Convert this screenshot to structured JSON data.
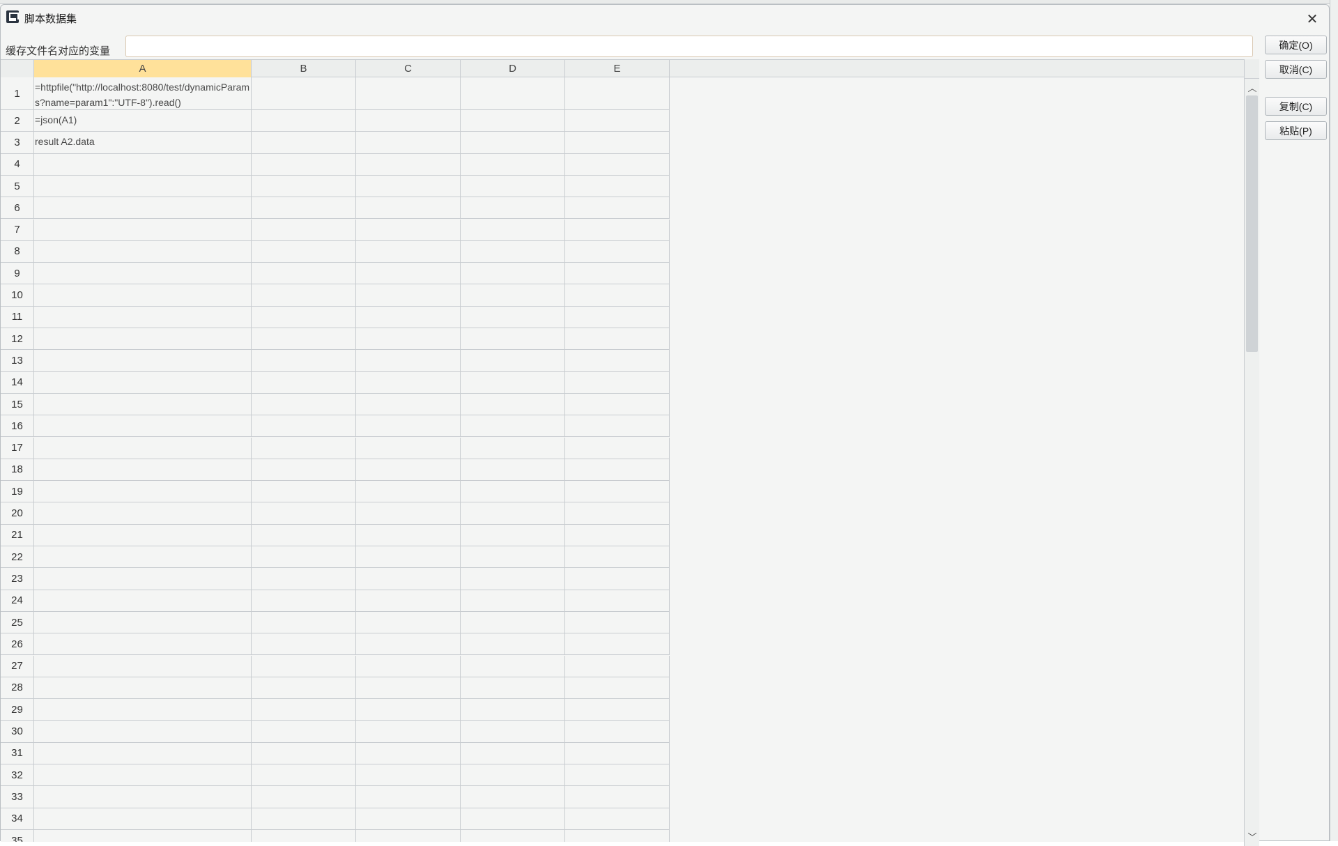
{
  "window": {
    "title": "脚本数据集",
    "close_glyph": "✕"
  },
  "variable": {
    "label": "缓存文件名对应的变量",
    "value": "",
    "placeholder": ""
  },
  "buttons": {
    "ok": "确定(O)",
    "cancel": "取消(C)",
    "copy": "复制(C)",
    "paste": "粘贴(P)"
  },
  "columns": [
    "A",
    "B",
    "C",
    "D",
    "E"
  ],
  "selected_column": "A",
  "rows": [
    {
      "num": "1",
      "cells": [
        "=httpfile(\"http://localhost:8080/test/dynamicParams?name=param1\":\"UTF-8\").read()",
        "",
        "",
        "",
        ""
      ]
    },
    {
      "num": "2",
      "cells": [
        "=json(A1)",
        "",
        "",
        "",
        ""
      ]
    },
    {
      "num": "3",
      "cells": [
        "result A2.data",
        "",
        "",
        "",
        ""
      ]
    },
    {
      "num": "4",
      "cells": [
        "",
        "",
        "",
        "",
        ""
      ]
    },
    {
      "num": "5",
      "cells": [
        "",
        "",
        "",
        "",
        ""
      ]
    },
    {
      "num": "6",
      "cells": [
        "",
        "",
        "",
        "",
        ""
      ]
    },
    {
      "num": "7",
      "cells": [
        "",
        "",
        "",
        "",
        ""
      ]
    },
    {
      "num": "8",
      "cells": [
        "",
        "",
        "",
        "",
        ""
      ]
    },
    {
      "num": "9",
      "cells": [
        "",
        "",
        "",
        "",
        ""
      ]
    },
    {
      "num": "10",
      "cells": [
        "",
        "",
        "",
        "",
        ""
      ]
    },
    {
      "num": "11",
      "cells": [
        "",
        "",
        "",
        "",
        ""
      ]
    },
    {
      "num": "12",
      "cells": [
        "",
        "",
        "",
        "",
        ""
      ]
    },
    {
      "num": "13",
      "cells": [
        "",
        "",
        "",
        "",
        ""
      ]
    },
    {
      "num": "14",
      "cells": [
        "",
        "",
        "",
        "",
        ""
      ]
    },
    {
      "num": "15",
      "cells": [
        "",
        "",
        "",
        "",
        ""
      ]
    },
    {
      "num": "16",
      "cells": [
        "",
        "",
        "",
        "",
        ""
      ]
    },
    {
      "num": "17",
      "cells": [
        "",
        "",
        "",
        "",
        ""
      ]
    },
    {
      "num": "18",
      "cells": [
        "",
        "",
        "",
        "",
        ""
      ]
    },
    {
      "num": "19",
      "cells": [
        "",
        "",
        "",
        "",
        ""
      ]
    },
    {
      "num": "20",
      "cells": [
        "",
        "",
        "",
        "",
        ""
      ]
    },
    {
      "num": "21",
      "cells": [
        "",
        "",
        "",
        "",
        ""
      ]
    },
    {
      "num": "22",
      "cells": [
        "",
        "",
        "",
        "",
        ""
      ]
    },
    {
      "num": "23",
      "cells": [
        "",
        "",
        "",
        "",
        ""
      ]
    },
    {
      "num": "24",
      "cells": [
        "",
        "",
        "",
        "",
        ""
      ]
    },
    {
      "num": "25",
      "cells": [
        "",
        "",
        "",
        "",
        ""
      ]
    },
    {
      "num": "26",
      "cells": [
        "",
        "",
        "",
        "",
        ""
      ]
    },
    {
      "num": "27",
      "cells": [
        "",
        "",
        "",
        "",
        ""
      ]
    },
    {
      "num": "28",
      "cells": [
        "",
        "",
        "",
        "",
        ""
      ]
    },
    {
      "num": "29",
      "cells": [
        "",
        "",
        "",
        "",
        ""
      ]
    },
    {
      "num": "30",
      "cells": [
        "",
        "",
        "",
        "",
        ""
      ]
    },
    {
      "num": "31",
      "cells": [
        "",
        "",
        "",
        "",
        ""
      ]
    },
    {
      "num": "32",
      "cells": [
        "",
        "",
        "",
        "",
        ""
      ]
    },
    {
      "num": "33",
      "cells": [
        "",
        "",
        "",
        "",
        ""
      ]
    },
    {
      "num": "34",
      "cells": [
        "",
        "",
        "",
        "",
        ""
      ]
    },
    {
      "num": "35",
      "cells": [
        "",
        "",
        "",
        "",
        ""
      ]
    }
  ],
  "scrollbar": {
    "up_glyph": "︿",
    "down_glyph": "﹀"
  },
  "colors": {
    "selected_column_header": "#ffe19a",
    "grid_line": "#c8ccd0",
    "background": "#f4f5f4"
  }
}
